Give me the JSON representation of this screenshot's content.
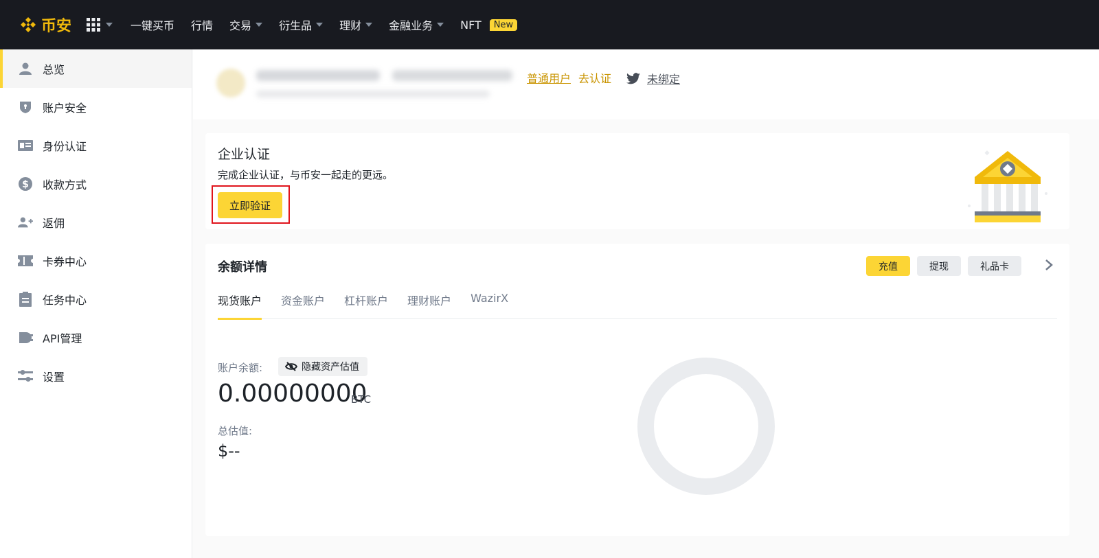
{
  "colors": {
    "brand": "#f0b90b",
    "accent": "#fcd535",
    "nav_bg": "#181a20",
    "highlight": "#e0141c"
  },
  "topnav": {
    "logo_text": "币安",
    "items": [
      {
        "label": "一键买币",
        "dropdown": false
      },
      {
        "label": "行情",
        "dropdown": false
      },
      {
        "label": "交易",
        "dropdown": true
      },
      {
        "label": "衍生品",
        "dropdown": true
      },
      {
        "label": "理财",
        "dropdown": true
      },
      {
        "label": "金融业务",
        "dropdown": true
      },
      {
        "label": "NFT",
        "dropdown": false
      }
    ],
    "nft_badge": "New"
  },
  "sidebar": {
    "items": [
      {
        "label": "总览",
        "icon": "user-icon",
        "active": true
      },
      {
        "label": "账户安全",
        "icon": "shield-icon"
      },
      {
        "label": "身份认证",
        "icon": "id-card-icon"
      },
      {
        "label": "收款方式",
        "icon": "dollar-icon"
      },
      {
        "label": "返佣",
        "icon": "add-user-icon"
      },
      {
        "label": "卡券中心",
        "icon": "ticket-icon"
      },
      {
        "label": "任务中心",
        "icon": "clipboard-icon"
      },
      {
        "label": "API管理",
        "icon": "api-icon"
      },
      {
        "label": "设置",
        "icon": "sliders-icon"
      }
    ]
  },
  "profile": {
    "user_type": "普通用户",
    "go_verify": "去认证",
    "twitter_status": "未绑定"
  },
  "enterprise": {
    "title": "企业认证",
    "description": "完成企业认证，与币安一起走的更远。",
    "verify_button": "立即验证"
  },
  "balance": {
    "title": "余额详情",
    "actions": {
      "deposit": "充值",
      "withdraw": "提现",
      "gift_card": "礼品卡"
    },
    "tabs": [
      "现货账户",
      "资金账户",
      "杠杆账户",
      "理财账户",
      "WazirX"
    ],
    "account_label": "账户余额:",
    "hide_button": "隐藏资产估值",
    "amount": "0.00000000",
    "unit": "BTC",
    "total_label": "总估值:",
    "total_value": "$--"
  }
}
